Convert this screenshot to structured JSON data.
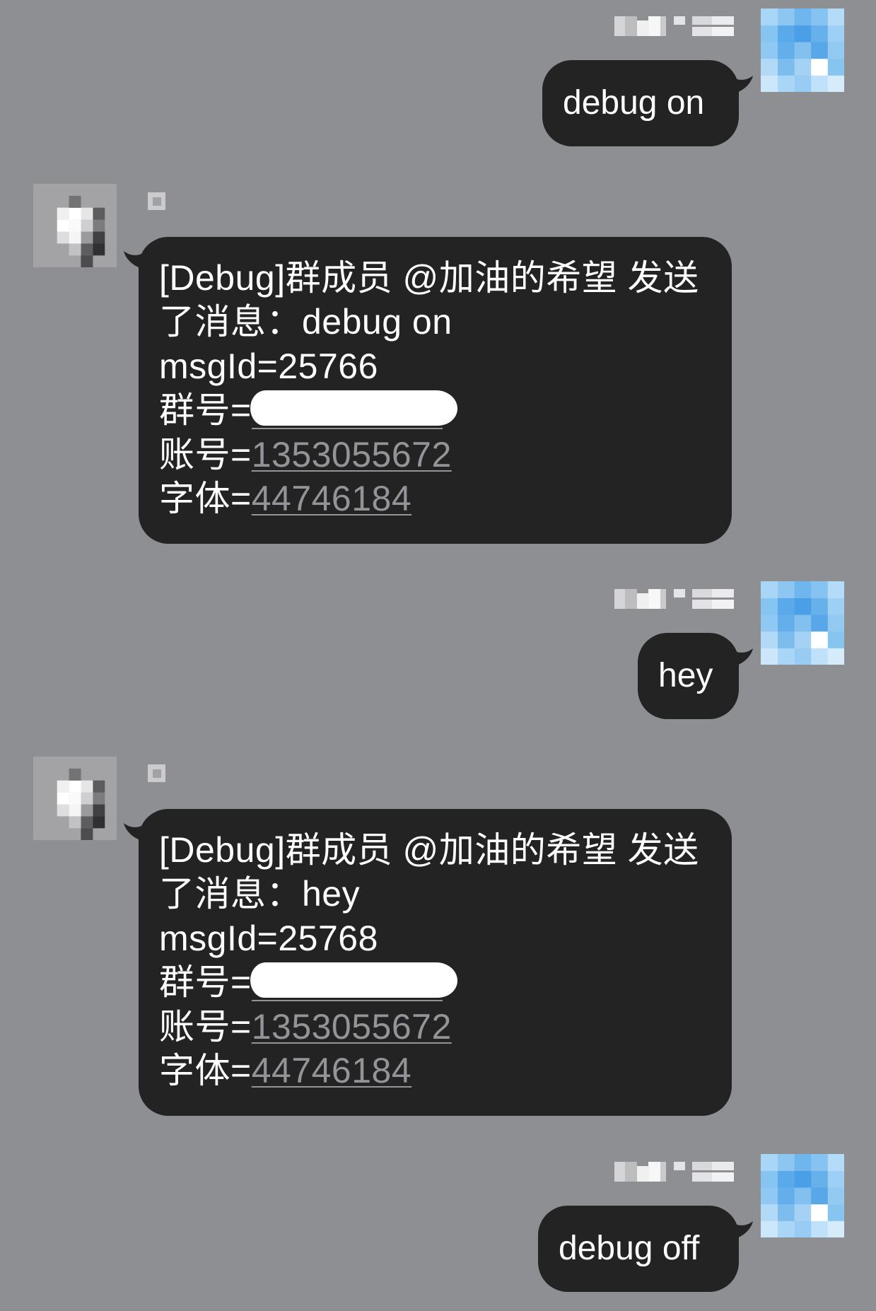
{
  "colors": {
    "background": "#8e8f93",
    "bubble": "#232323",
    "bubble_text": "#ffffff",
    "link": "#939398",
    "redaction": "#ffffff"
  },
  "icons": {
    "outgoing_avatar": "user-avatar-icon",
    "incoming_avatar": "bot-avatar-icon",
    "bubble_tail": "bubble-tail-icon"
  },
  "messages": [
    {
      "text": "debug on"
    },
    {
      "line1": "[Debug]群成员 @加油的希望 发送",
      "line2": "了消息：debug on",
      "msg_id": "msgId=25766",
      "group_label": "群号=",
      "account_label": "账号=",
      "account_value": "1353055672",
      "font_label": "字体=",
      "font_value": "44746184"
    },
    {
      "text": "hey"
    },
    {
      "line1": "[Debug]群成员 @加油的希望 发送",
      "line2": "了消息：hey",
      "msg_id": "msgId=25768",
      "group_label": "群号=",
      "account_label": "账号=",
      "account_value": "1353055672",
      "font_label": "字体=",
      "font_value": "44746184"
    },
    {
      "text": "debug off"
    }
  ]
}
